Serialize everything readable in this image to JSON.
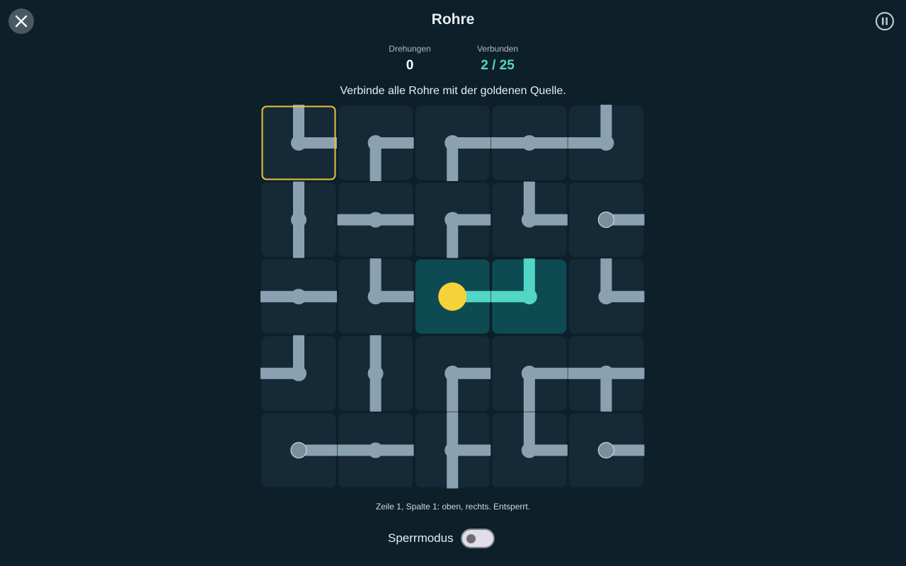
{
  "header": {
    "title": "Rohre"
  },
  "stats": {
    "moves_label": "Drehungen",
    "moves_value": "0",
    "connected_label": "Verbunden",
    "connected_value": "2 / 25"
  },
  "instruction": "Verbinde alle Rohre mit der goldenen Quelle.",
  "board": {
    "rows": 5,
    "cols": 5,
    "selected_cell": [
      0,
      0
    ],
    "source_cell": [
      2,
      2
    ],
    "colors": {
      "tile": "#152a36",
      "tile_connected": "#0d4a52",
      "pipe": "#8aa1b1",
      "pipe_connected": "#52d6c6",
      "source": "#f6d23a",
      "selection": "#e8c33c",
      "endpoint": "#7a8f9d"
    },
    "tiles": [
      [
        {
          "openings": [
            "up",
            "right"
          ],
          "connected": false
        },
        {
          "openings": [
            "right",
            "down"
          ],
          "connected": false
        },
        {
          "openings": [
            "right",
            "down"
          ],
          "connected": false
        },
        {
          "openings": [
            "left",
            "right"
          ],
          "connected": false
        },
        {
          "openings": [
            "up",
            "left"
          ],
          "connected": false
        }
      ],
      [
        {
          "openings": [
            "up",
            "down"
          ],
          "connected": false
        },
        {
          "openings": [
            "left",
            "right"
          ],
          "connected": false
        },
        {
          "openings": [
            "right",
            "down"
          ],
          "connected": false
        },
        {
          "openings": [
            "up",
            "right"
          ],
          "connected": false
        },
        {
          "openings": [
            "right"
          ],
          "connected": false
        }
      ],
      [
        {
          "openings": [
            "left",
            "right"
          ],
          "connected": false
        },
        {
          "openings": [
            "up",
            "right"
          ],
          "connected": false
        },
        {
          "openings": [
            "right"
          ],
          "connected": true,
          "source": true
        },
        {
          "openings": [
            "up",
            "left"
          ],
          "connected": true
        },
        {
          "openings": [
            "up",
            "right"
          ],
          "connected": false
        }
      ],
      [
        {
          "openings": [
            "up",
            "left"
          ],
          "connected": false
        },
        {
          "openings": [
            "up",
            "down"
          ],
          "connected": false
        },
        {
          "openings": [
            "right",
            "down"
          ],
          "connected": false
        },
        {
          "openings": [
            "right",
            "down"
          ],
          "connected": false
        },
        {
          "openings": [
            "left",
            "right",
            "down"
          ],
          "connected": false
        }
      ],
      [
        {
          "openings": [
            "right"
          ],
          "connected": false
        },
        {
          "openings": [
            "left",
            "right"
          ],
          "connected": false
        },
        {
          "openings": [
            "up",
            "right",
            "down"
          ],
          "connected": false
        },
        {
          "openings": [
            "up",
            "right"
          ],
          "connected": false
        },
        {
          "openings": [
            "right"
          ],
          "connected": false
        }
      ]
    ]
  },
  "status_text": "Zeile 1, Spalte 1: oben, rechts. Entsperrt.",
  "lock_mode": {
    "label": "Sperrmodus",
    "enabled": false
  },
  "icons": {
    "close": "close-icon",
    "pause": "pause-icon"
  }
}
